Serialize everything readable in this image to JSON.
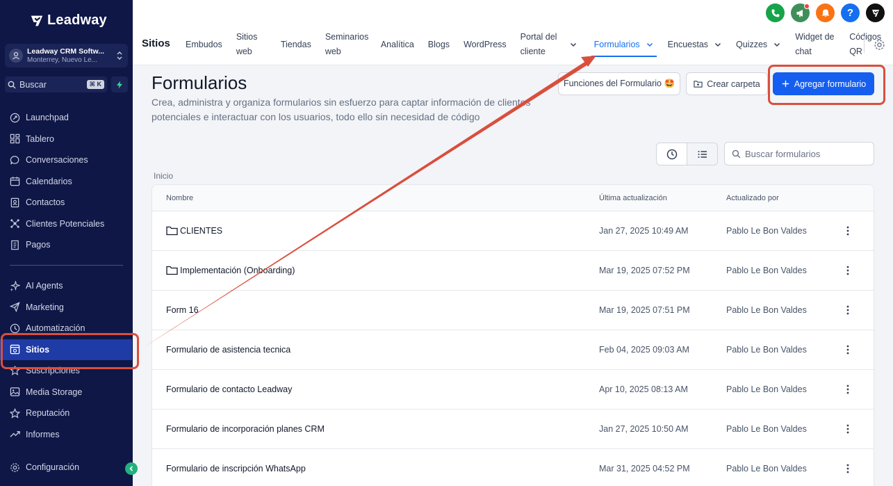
{
  "sidebar": {
    "brand": "Leadway",
    "account_name": "Leadway CRM Softw...",
    "account_location": "Monterrey, Nuevo Le...",
    "search_label": "Buscar",
    "search_shortcut": "⌘ K",
    "items_top": [
      {
        "label": "Launchpad",
        "icon": "rocket-icon"
      },
      {
        "label": "Tablero",
        "icon": "dashboard-icon"
      },
      {
        "label": "Conversaciones",
        "icon": "chat-icon"
      },
      {
        "label": "Calendarios",
        "icon": "calendar-icon"
      },
      {
        "label": "Contactos",
        "icon": "contacts-icon"
      },
      {
        "label": "Clientes Potenciales",
        "icon": "network-icon"
      },
      {
        "label": "Pagos",
        "icon": "receipt-icon"
      }
    ],
    "items_bottom": [
      {
        "label": "AI Agents",
        "icon": "sparkle-icon"
      },
      {
        "label": "Marketing",
        "icon": "send-icon"
      },
      {
        "label": "Automatización",
        "icon": "automation-icon"
      },
      {
        "label": "Sitios",
        "icon": "sites-icon",
        "active": true
      },
      {
        "label": "Suscripciones",
        "icon": "badge-icon"
      },
      {
        "label": "Media Storage",
        "icon": "image-icon"
      },
      {
        "label": "Reputación",
        "icon": "star-icon"
      },
      {
        "label": "Informes",
        "icon": "trend-icon"
      }
    ],
    "settings_label": "Configuración"
  },
  "header": {
    "section": "Sitios",
    "tabs": [
      {
        "label": "Embudos"
      },
      {
        "label": "Sitios web"
      },
      {
        "label": "Tiendas"
      },
      {
        "label": "Seminarios web"
      },
      {
        "label": "Analítica"
      },
      {
        "label": "Blogs"
      },
      {
        "label": "WordPress"
      },
      {
        "label": "Portal del cliente",
        "dropdown": true
      },
      {
        "label": "Formularios",
        "dropdown": true,
        "active": true
      },
      {
        "label": "Encuestas",
        "dropdown": true
      },
      {
        "label": "Quizzes",
        "dropdown": true
      },
      {
        "label": "Widget de chat"
      },
      {
        "label": "Códigos QR"
      }
    ],
    "help_glyph": "?"
  },
  "colors": {
    "sidebar_bg": "#0f1747",
    "active_nav": "#1e3ba6",
    "accent": "#155eef",
    "annotation": "#d94f3d"
  },
  "main": {
    "title": "Formularios",
    "description": "Crea, administra y organiza formularios sin esfuerzo para captar información de clientes potenciales e interactuar con los usuarios, todo ello sin necesidad de código",
    "btn_features": "Funciones del Formulario 🤩",
    "btn_folder": "Crear carpeta",
    "btn_add": "Agregar formulario",
    "search_placeholder": "Buscar formularios",
    "breadcrumb": "Inicio",
    "columns": {
      "name": "Nombre",
      "updated": "Última actualización",
      "by": "Actualizado por"
    },
    "rows": [
      {
        "name": "CLIENTES",
        "folder": true,
        "date": "Jan 27, 2025 10:49 AM",
        "by": "Pablo Le Bon Valdes"
      },
      {
        "name": "Implementación (Onboarding)",
        "folder": true,
        "date": "Mar 19, 2025 07:52 PM",
        "by": "Pablo Le Bon Valdes"
      },
      {
        "name": "Form 16",
        "folder": false,
        "date": "Mar 19, 2025 07:51 PM",
        "by": "Pablo Le Bon Valdes"
      },
      {
        "name": "Formulario de asistencia tecnica",
        "folder": false,
        "date": "Feb 04, 2025 09:03 AM",
        "by": "Pablo Le Bon Valdes"
      },
      {
        "name": "Formulario de contacto Leadway",
        "folder": false,
        "date": "Apr 10, 2025 08:13 AM",
        "by": "Pablo Le Bon Valdes"
      },
      {
        "name": "Formulario de incorporación planes CRM",
        "folder": false,
        "date": "Jan 27, 2025 10:50 AM",
        "by": "Pablo Le Bon Valdes"
      },
      {
        "name": "Formulario de inscripción WhatsApp",
        "folder": false,
        "date": "Mar 31, 2025 04:52 PM",
        "by": "Pablo Le Bon Valdes"
      }
    ]
  }
}
